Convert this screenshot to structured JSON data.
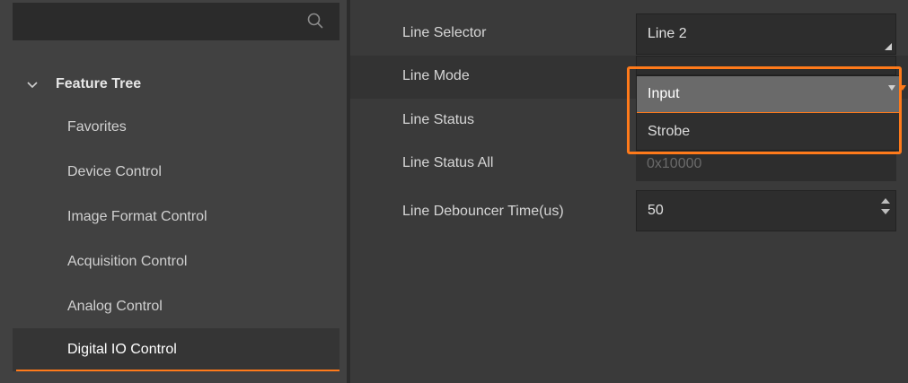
{
  "search": {
    "placeholder": ""
  },
  "feature_tree": {
    "title": "Feature Tree",
    "items": [
      {
        "label": "Favorites"
      },
      {
        "label": "Device Control"
      },
      {
        "label": "Image Format Control"
      },
      {
        "label": "Acquisition Control"
      },
      {
        "label": "Analog Control"
      },
      {
        "label": "Digital IO Control"
      }
    ],
    "active_item": "Digital IO Control"
  },
  "properties": {
    "line_selector": {
      "label": "Line Selector",
      "value": "Line 2"
    },
    "line_mode": {
      "label": "Line Mode",
      "options": [
        "Input",
        "Strobe"
      ],
      "selected": "Input"
    },
    "line_status": {
      "label": "Line Status"
    },
    "line_status_all": {
      "label": "Line Status All",
      "value": "0x10000"
    },
    "line_debouncer_time": {
      "label": "Line Debouncer Time(us)",
      "value": "50"
    }
  },
  "colors": {
    "accent": "#ff7a1a",
    "panel_bg": "#414141",
    "content_bg": "#3a3a3a",
    "field_bg": "#2d2d2d"
  }
}
